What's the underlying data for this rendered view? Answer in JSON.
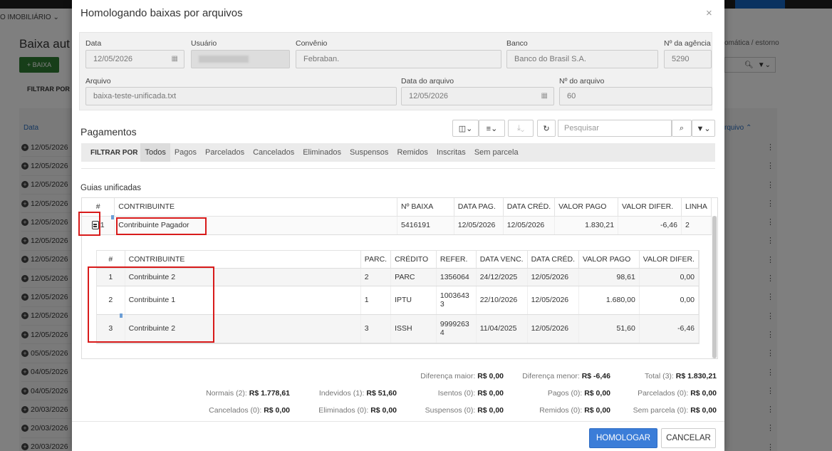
{
  "background": {
    "menu": "O IMOBILIÁRIO ⌄",
    "page_title": "Baixa aut",
    "add_button": "+ BAIXA",
    "filter_label": "FILTRAR POR",
    "col_data": "Data",
    "right_note": "omática / estorno",
    "right_col": "rquivo ⌃",
    "dates": [
      "12/05/2026",
      "12/05/2026",
      "12/05/2026",
      "12/05/2026",
      "12/05/2026",
      "12/05/2026",
      "12/05/2026",
      "12/05/2026",
      "12/05/2026",
      "12/05/2026",
      "12/05/2026",
      "05/05/2026",
      "04/05/2026",
      "04/05/2026",
      "20/03/2026",
      "20/03/2026",
      "20/03/2026"
    ]
  },
  "modal": {
    "title": "Homologando baixas por arquivos",
    "close": "×",
    "fields": {
      "data_label": "Data",
      "data_value": "12/05/2026",
      "usuario_label": "Usuário",
      "convenio_label": "Convênio",
      "convenio_value": "Febraban.",
      "banco_label": "Banco",
      "banco_value": "Banco do Brasil S.A.",
      "agencia_label": "Nº da agência",
      "agencia_value": "5290",
      "arquivo_label": "Arquivo",
      "arquivo_value": "baixa-teste-unificada.txt",
      "data_arquivo_label": "Data do arquivo",
      "data_arquivo_value": "12/05/2026",
      "num_arquivo_label": "Nº do arquivo",
      "num_arquivo_value": "60"
    },
    "pagamentos_title": "Pagamentos",
    "search_placeholder": "Pesquisar",
    "filter_label": "FILTRAR POR",
    "filter_tabs": [
      "Todos",
      "Pagos",
      "Parcelados",
      "Cancelados",
      "Eliminados",
      "Suspensos",
      "Remidos",
      "Inscritas",
      "Sem parcela"
    ],
    "guias_title": "Guias unificadas",
    "outer_headers": [
      "#",
      "CONTRIBUINTE",
      "Nº BAIXA",
      "DATA PAG.",
      "DATA CRÉD.",
      "VALOR PAGO",
      "VALOR DIFER.",
      "LINHA"
    ],
    "outer_row": {
      "num": "1",
      "contribuinte": "Contribuinte Pagador",
      "n_baixa": "5416191",
      "data_pag": "12/05/2026",
      "data_cred": "12/05/2026",
      "valor_pago": "1.830,21",
      "valor_difer": "-6,46",
      "linha": "2"
    },
    "inner_headers": [
      "#",
      "CONTRIBUINTE",
      "PARC.",
      "CRÉDITO",
      "REFER.",
      "DATA VENC.",
      "DATA CRÉD.",
      "VALOR PAGO",
      "VALOR DIFER."
    ],
    "inner_rows": [
      {
        "num": "1",
        "contribuinte": "Contribuinte 2",
        "parc": "2",
        "credito": "PARC",
        "refer": "1356064",
        "data_venc": "24/12/2025",
        "data_cred": "12/05/2026",
        "valor_pago": "98,61",
        "valor_difer": "0,00"
      },
      {
        "num": "2",
        "contribuinte": "Contribuinte 1",
        "parc": "1",
        "credito": "IPTU",
        "refer": "1003643\n3",
        "data_venc": "22/10/2026",
        "data_cred": "12/05/2026",
        "valor_pago": "1.680,00",
        "valor_difer": "0,00"
      },
      {
        "num": "3",
        "contribuinte": "Contribuinte 2",
        "parc": "3",
        "credito": "ISSH",
        "refer": "9999263\n4",
        "data_venc": "11/04/2025",
        "data_cred": "12/05/2026",
        "valor_pago": "51,60",
        "valor_difer": "-6,46"
      }
    ],
    "summary": {
      "dif_maior_label": "Diferença maior:",
      "dif_maior": "R$ 0,00",
      "dif_menor_label": "Diferença menor:",
      "dif_menor": "R$ -6,46",
      "total_label": "Total (3):",
      "total": "R$ 1.830,21",
      "normais_label": "Normais (2):",
      "normais": "R$ 1.778,61",
      "indevidos_label": "Indevidos (1):",
      "indevidos": "R$ 51,60",
      "isentos_label": "Isentos (0):",
      "isentos": "R$ 0,00",
      "pagos_label": "Pagos (0):",
      "pagos": "R$ 0,00",
      "parcelados_label": "Parcelados (0):",
      "parcelados": "R$ 0,00",
      "cancelados_label": "Cancelados (0):",
      "cancelados": "R$ 0,00",
      "eliminados_label": "Eliminados (0):",
      "eliminados": "R$ 0,00",
      "suspensos_label": "Suspensos (0):",
      "suspensos": "R$ 0,00",
      "remidos_label": "Remidos (0):",
      "remidos": "R$ 0,00",
      "sem_parcela_label": "Sem parcela (0):",
      "sem_parcela": "R$ 0,00"
    },
    "homologar_button": "HOMOLOGAR",
    "cancelar_button": "CANCELAR"
  },
  "colors": {
    "primary": "#3b7dd8",
    "highlight": "#d81b1b",
    "success": "#2e7d32"
  }
}
